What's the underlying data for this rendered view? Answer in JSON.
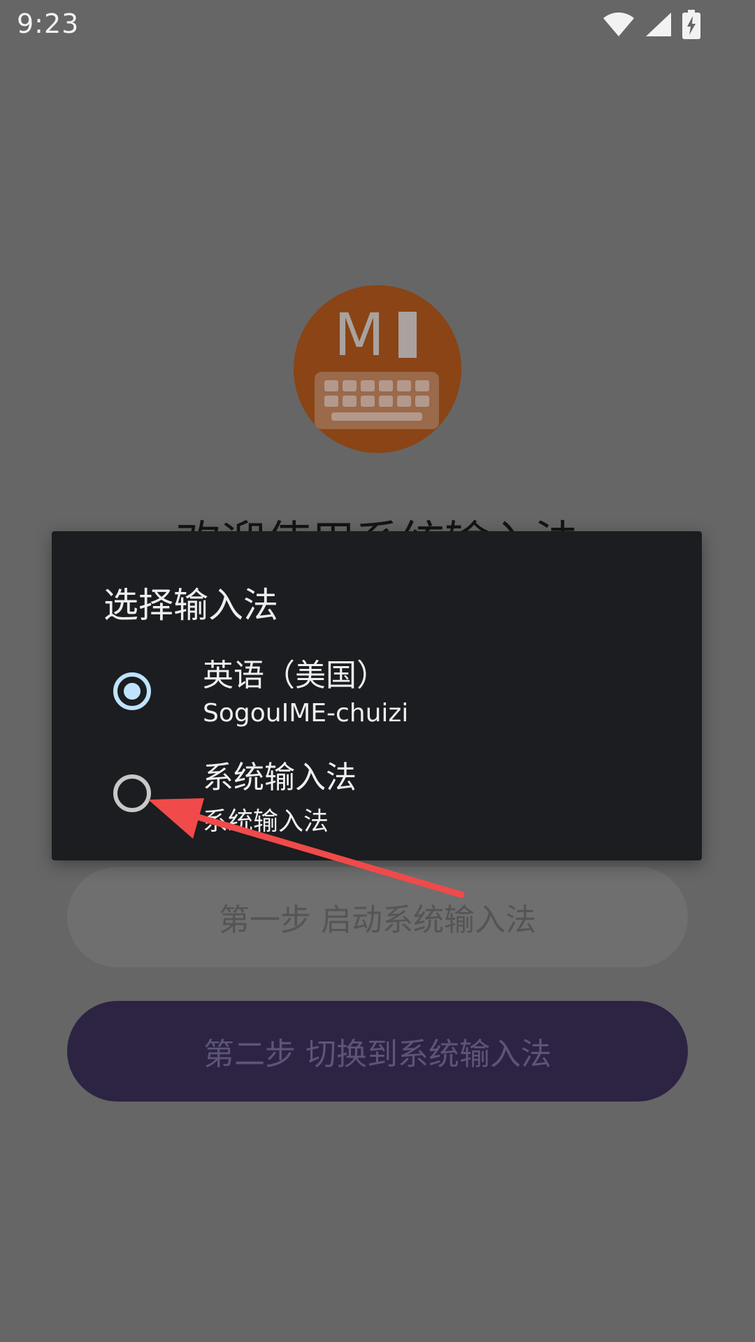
{
  "status_bar": {
    "time": "9:23",
    "icons": [
      "wifi-icon",
      "signal-icon",
      "battery-charging-icon"
    ]
  },
  "app": {
    "logo_letter": "M",
    "welcome_title": "欢迎使用系统输入法",
    "step1_label": "第一步 启动系统输入法",
    "step2_label": "第二步 切换到系统输入法"
  },
  "dialog": {
    "title": "选择输入法",
    "options": [
      {
        "label": "英语（美国）",
        "sublabel": "SogouIME-chuizi",
        "selected": true
      },
      {
        "label": "系统输入法",
        "sublabel": "系统输入法",
        "selected": false
      }
    ]
  },
  "colors": {
    "scrim": "#666666",
    "dialog_bg": "#1b1d20",
    "radio_selected": "#bfe3ff",
    "annotation_arrow": "#f04a4a",
    "logo_bg": "#8a4415",
    "step2_bg": "#2d2343"
  }
}
